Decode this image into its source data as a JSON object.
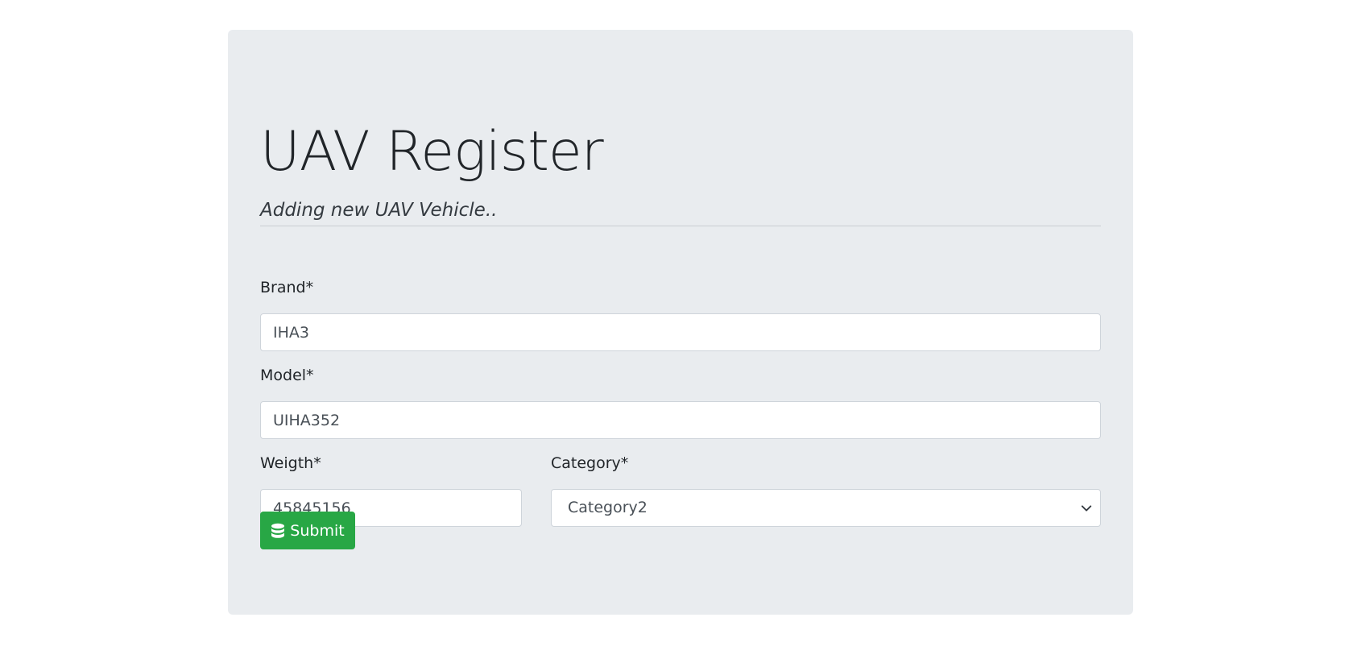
{
  "header": {
    "title": "UAV Register",
    "subtitle": "Adding new UAV Vehicle.."
  },
  "form": {
    "brand": {
      "label": "Brand*",
      "value": "IHA3"
    },
    "model": {
      "label": "Model*",
      "value": "UIHA352"
    },
    "weight": {
      "label": "Weigth*",
      "value": "45845156"
    },
    "category": {
      "label": "Category*",
      "selected": "Category2"
    },
    "submit": {
      "label": "Submit",
      "icon": "database-icon"
    }
  },
  "colors": {
    "panel_bg": "#e9ecef",
    "submit_bg": "#28a745",
    "input_border": "#ced4da"
  }
}
